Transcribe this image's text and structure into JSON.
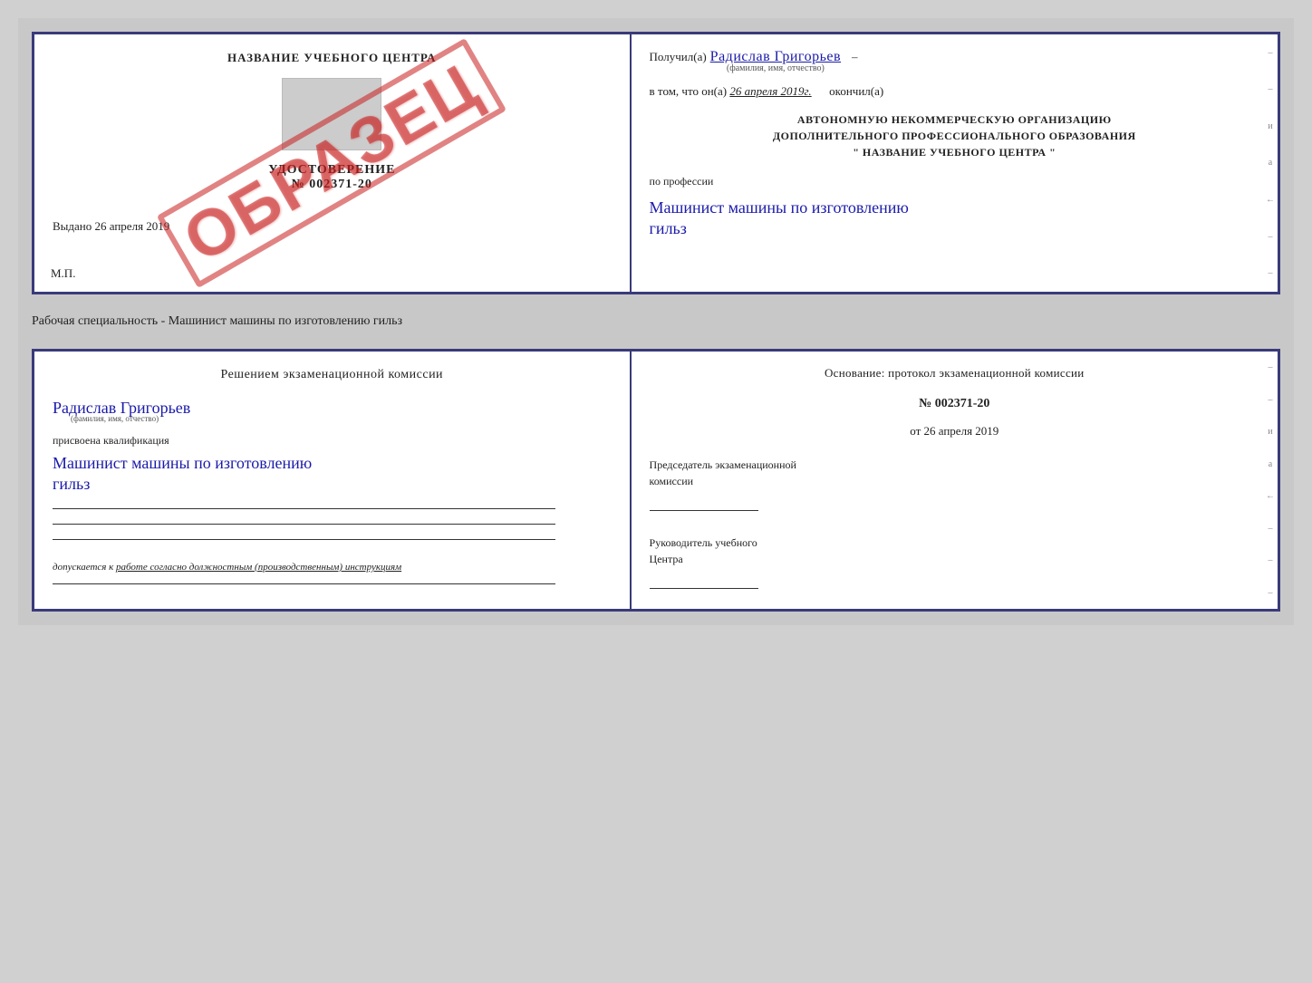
{
  "top_doc": {
    "left": {
      "center_title": "НАЗВАНИЕ УЧЕБНОГО ЦЕНТРА",
      "udostoverenie": "УДОСТОВЕРЕНИЕ",
      "number": "№ 002371-20",
      "vudano_label": "Выдано",
      "vudano_date": "26 апреля 2019",
      "mp_label": "М.П.",
      "obrazec": "ОБРАЗЕЦ"
    },
    "right": {
      "poluchil_label": "Получил(а)",
      "recipient_name": "Радислав Григорьев",
      "fio_label": "(фамилия, имя, отчество)",
      "v_tom_label": "в том, что он(а)",
      "date_value": "26 апреля 2019г.",
      "okonchil_label": "окончил(а)",
      "org_line1": "АВТОНОМНУЮ НЕКОММЕРЧЕСКУЮ ОРГАНИЗАЦИЮ",
      "org_line2": "ДОПОЛНИТЕЛЬНОГО ПРОФЕССИОНАЛЬНОГО ОБРАЗОВАНИЯ",
      "org_line3": "\"   НАЗВАНИЕ УЧЕБНОГО ЦЕНТРА   \"",
      "po_professii": "по профессии",
      "profession_name": "Машинист машины по изготовлению",
      "profession_name2": "гильз"
    }
  },
  "separator": {
    "label": "Рабочая специальность - Машинист машины по изготовлению гильз"
  },
  "bottom_doc": {
    "left": {
      "resheniem_title": "Решением  экзаменационной  комиссии",
      "person_name": "Радислав Григорьев",
      "fio_label": "(фамилия, имя, отчество)",
      "prisvoena_label": "присвоена квалификация",
      "kvalif_name": "Машинист  машины  по  изготовлению",
      "kvalif_name2": "гильз",
      "dopusk_label": "допускается к",
      "dopusk_text": "работе согласно должностным (производственным) инструкциям"
    },
    "right": {
      "osnov_label": "Основание: протокол экзаменационной  комиссии",
      "protocol_number": "№  002371-20",
      "protocol_date_prefix": "от",
      "protocol_date": "26 апреля 2019",
      "predsed_line1": "Председатель экзаменационной",
      "predsed_line2": "комиссии",
      "rukoved_line1": "Руководитель учебного",
      "rukoved_line2": "Центра"
    }
  }
}
